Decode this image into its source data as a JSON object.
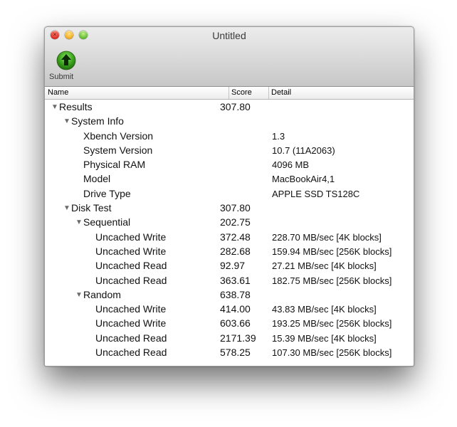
{
  "window": {
    "title": "Untitled"
  },
  "toolbar": {
    "submit_label": "Submit"
  },
  "columns": {
    "name": "Name",
    "score": "Score",
    "detail": "Detail"
  },
  "rows": [
    {
      "name": "Results",
      "score": "307.80",
      "detail": "",
      "level": 0,
      "expandable": true
    },
    {
      "name": "System Info",
      "score": "",
      "detail": "",
      "level": 1,
      "expandable": true
    },
    {
      "name": "Xbench Version",
      "score": "",
      "detail": "1.3",
      "level": 2,
      "expandable": false
    },
    {
      "name": "System Version",
      "score": "",
      "detail": "10.7 (11A2063)",
      "level": 2,
      "expandable": false
    },
    {
      "name": "Physical RAM",
      "score": "",
      "detail": "4096 MB",
      "level": 2,
      "expandable": false
    },
    {
      "name": "Model",
      "score": "",
      "detail": "MacBookAir4,1",
      "level": 2,
      "expandable": false
    },
    {
      "name": "Drive Type",
      "score": "",
      "detail": "APPLE SSD TS128C",
      "level": 2,
      "expandable": false
    },
    {
      "name": "Disk Test",
      "score": "307.80",
      "detail": "",
      "level": 1,
      "expandable": true
    },
    {
      "name": "Sequential",
      "score": "202.75",
      "detail": "",
      "level": 2,
      "expandable": true
    },
    {
      "name": "Uncached Write",
      "score": "372.48",
      "detail": "228.70 MB/sec [4K blocks]",
      "level": 3,
      "expandable": false
    },
    {
      "name": "Uncached Write",
      "score": "282.68",
      "detail": "159.94 MB/sec [256K blocks]",
      "level": 3,
      "expandable": false
    },
    {
      "name": "Uncached Read",
      "score": "92.97",
      "detail": "27.21 MB/sec [4K blocks]",
      "level": 3,
      "expandable": false
    },
    {
      "name": "Uncached Read",
      "score": "363.61",
      "detail": "182.75 MB/sec [256K blocks]",
      "level": 3,
      "expandable": false
    },
    {
      "name": "Random",
      "score": "638.78",
      "detail": "",
      "level": 2,
      "expandable": true
    },
    {
      "name": "Uncached Write",
      "score": "414.00",
      "detail": "43.83 MB/sec [4K blocks]",
      "level": 3,
      "expandable": false
    },
    {
      "name": "Uncached Write",
      "score": "603.66",
      "detail": "193.25 MB/sec [256K blocks]",
      "level": 3,
      "expandable": false
    },
    {
      "name": "Uncached Read",
      "score": "2171.39",
      "detail": "15.39 MB/sec [4K blocks]",
      "level": 3,
      "expandable": false
    },
    {
      "name": "Uncached Read",
      "score": "578.25",
      "detail": "107.30 MB/sec [256K blocks]",
      "level": 3,
      "expandable": false
    }
  ]
}
